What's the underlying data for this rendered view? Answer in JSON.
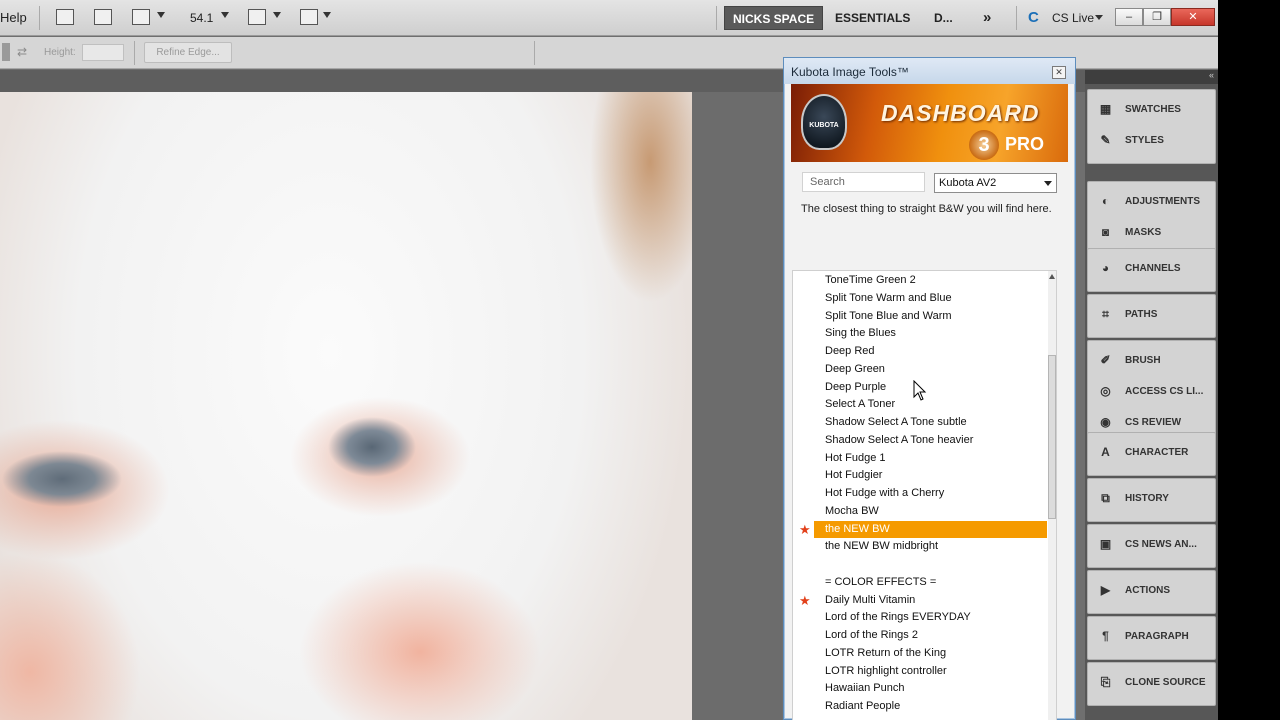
{
  "menubar": {
    "help_label": "Help",
    "zoom": "54.1",
    "workspaces": [
      "NICKS SPACE",
      "ESSENTIALS",
      "D..."
    ],
    "overflow_label": "»",
    "cs_live_label": "CS Live",
    "minimize_label": "–",
    "restore_label": "❐",
    "close_label": "✕"
  },
  "optionsbar": {
    "height_label": "Height:",
    "refine_edge_label": "Refine Edge..."
  },
  "kubota": {
    "title": "Kubota Image Tools™",
    "banner": {
      "logo_text": "KUBOTA",
      "dash_text": "DASHBOARD",
      "version": "3",
      "pro": "PRO"
    },
    "search_placeholder": "Search",
    "preset_selected": "Kubota AV2",
    "description": "The closest thing to straight B&W you will find here.",
    "list": [
      {
        "label": "ToneTime Green 2",
        "star": false,
        "selected": false
      },
      {
        "label": "Split Tone Warm and Blue",
        "star": false,
        "selected": false
      },
      {
        "label": "Split Tone Blue and Warm",
        "star": false,
        "selected": false
      },
      {
        "label": "Sing the Blues",
        "star": false,
        "selected": false
      },
      {
        "label": "Deep Red",
        "star": false,
        "selected": false
      },
      {
        "label": "Deep Green",
        "star": false,
        "selected": false
      },
      {
        "label": "Deep Purple",
        "star": false,
        "selected": false
      },
      {
        "label": "Select A Toner",
        "star": false,
        "selected": false
      },
      {
        "label": "Shadow Select A Tone subtle",
        "star": false,
        "selected": false
      },
      {
        "label": "Shadow Select A Tone heavier",
        "star": false,
        "selected": false
      },
      {
        "label": "Hot Fudge 1",
        "star": false,
        "selected": false
      },
      {
        "label": "Hot Fudgier",
        "star": false,
        "selected": false
      },
      {
        "label": "Hot Fudge with a Cherry",
        "star": false,
        "selected": false
      },
      {
        "label": "Mocha BW",
        "star": false,
        "selected": false
      },
      {
        "label": "the NEW BW",
        "star": true,
        "selected": true
      },
      {
        "label": "the NEW BW midbright",
        "star": false,
        "selected": false
      },
      {
        "label": "",
        "star": false,
        "selected": false
      },
      {
        "label": "= COLOR EFFECTS =",
        "star": false,
        "selected": false
      },
      {
        "label": "Daily Multi Vitamin",
        "star": true,
        "selected": false
      },
      {
        "label": "Lord of the Rings EVERYDAY",
        "star": false,
        "selected": false
      },
      {
        "label": "Lord of the Rings 2",
        "star": false,
        "selected": false
      },
      {
        "label": "LOTR Return of the King",
        "star": false,
        "selected": false
      },
      {
        "label": "LOTR highlight controller",
        "star": false,
        "selected": false
      },
      {
        "label": "Hawaiian Punch",
        "star": false,
        "selected": false
      },
      {
        "label": "Radiant People",
        "star": false,
        "selected": false
      }
    ]
  },
  "dock": {
    "groups": [
      {
        "items": [
          {
            "label": "SWATCHES",
            "icon": "swatches-icon",
            "glyph": "▦"
          },
          {
            "label": "STYLES",
            "icon": "styles-icon",
            "glyph": "✎"
          }
        ]
      },
      {
        "items": [
          {
            "label": "ADJUSTMENTS",
            "icon": "adjustments-icon",
            "glyph": "◐"
          },
          {
            "label": "MASKS",
            "icon": "masks-icon",
            "glyph": "◙"
          }
        ]
      },
      {
        "items": [
          {
            "label": "CHANNELS",
            "icon": "channels-icon",
            "glyph": "◕"
          }
        ]
      },
      {
        "items": [
          {
            "label": "PATHS",
            "icon": "paths-icon",
            "glyph": "⌗"
          }
        ]
      },
      {
        "items": [
          {
            "label": "BRUSH",
            "icon": "brush-icon",
            "glyph": "✐"
          },
          {
            "label": "ACCESS CS LI...",
            "icon": "access-cs-live-icon",
            "glyph": "◎"
          },
          {
            "label": "CS REVIEW",
            "icon": "cs-review-icon",
            "glyph": "◉"
          }
        ]
      },
      {
        "items": [
          {
            "label": "CHARACTER",
            "icon": "character-icon",
            "glyph": "A"
          }
        ]
      },
      {
        "items": [
          {
            "label": "HISTORY",
            "icon": "history-icon",
            "glyph": "⧉"
          }
        ]
      },
      {
        "items": [
          {
            "label": "CS NEWS AN...",
            "icon": "cs-news-icon",
            "glyph": "▣"
          }
        ]
      },
      {
        "items": [
          {
            "label": "ACTIONS",
            "icon": "actions-icon",
            "glyph": "▶"
          }
        ]
      },
      {
        "items": [
          {
            "label": "PARAGRAPH",
            "icon": "paragraph-icon",
            "glyph": "¶"
          }
        ]
      },
      {
        "items": [
          {
            "label": "CLONE SOURCE",
            "icon": "clone-source-icon",
            "glyph": "⎘"
          }
        ]
      }
    ]
  }
}
